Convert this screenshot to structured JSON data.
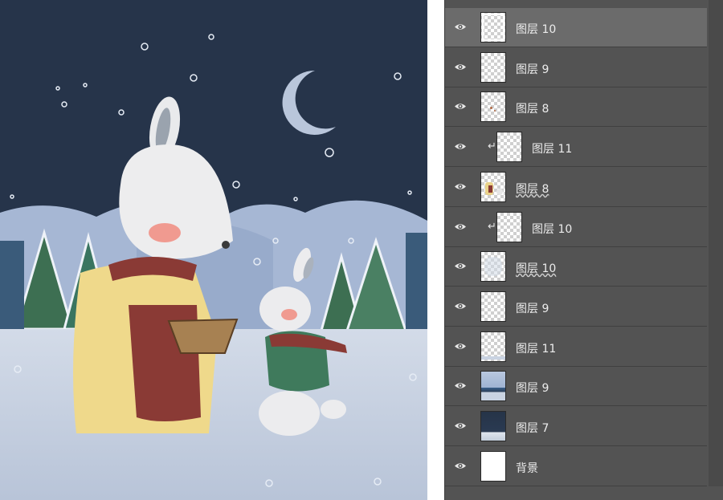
{
  "colors": {
    "sky": "#26344a",
    "snow_ground": "#c7d1e2",
    "hills": "#a6b7d4",
    "tree_green": "#3d6f52",
    "panel_bg": "#535353",
    "row_selected": "#6b6b6b",
    "dress": "#efd98b",
    "apron": "#8a3a35"
  },
  "layers_panel": {
    "layers": [
      {
        "name": "图层 10",
        "thumb": "selected-transparent",
        "clipped": false,
        "selected": true,
        "underlined": false
      },
      {
        "name": "图层 9",
        "thumb": "transparent",
        "clipped": false,
        "selected": false,
        "underlined": false
      },
      {
        "name": "图层 8",
        "thumb": "transparent-dots",
        "clipped": false,
        "selected": false,
        "underlined": false
      },
      {
        "name": "图层 11",
        "thumb": "transparent",
        "clipped": true,
        "selected": false,
        "underlined": false
      },
      {
        "name": "图层 8",
        "thumb": "transparent-figures",
        "clipped": false,
        "selected": false,
        "underlined": true
      },
      {
        "name": "图层 10",
        "thumb": "transparent",
        "clipped": true,
        "selected": false,
        "underlined": false
      },
      {
        "name": "图层 10",
        "thumb": "transparent-faint",
        "clipped": false,
        "selected": false,
        "underlined": true
      },
      {
        "name": "图层 9",
        "thumb": "transparent",
        "clipped": false,
        "selected": false,
        "underlined": false
      },
      {
        "name": "图层 11",
        "thumb": "transparent-ground",
        "clipped": false,
        "selected": false,
        "underlined": false
      },
      {
        "name": "图层 9",
        "thumb": "snowscape",
        "clipped": false,
        "selected": false,
        "underlined": false
      },
      {
        "name": "图层 7",
        "thumb": "night",
        "clipped": false,
        "selected": false,
        "underlined": false
      },
      {
        "name": "背景",
        "thumb": "white",
        "clipped": false,
        "selected": false,
        "underlined": false
      }
    ]
  }
}
